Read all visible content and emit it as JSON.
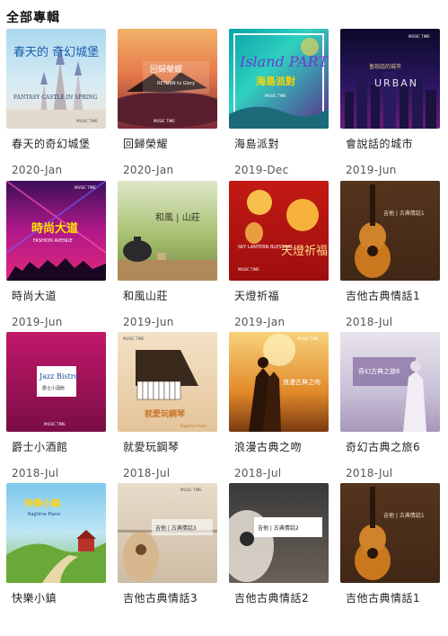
{
  "page_title": "全部專輯",
  "albums": [
    {
      "name": "春天的奇幻城堡",
      "date": "2020-Jan",
      "cover_text": "春天的 奇幻城堡",
      "cover_sub": "FANTASY CASTLE IN SPRING",
      "badge": "MUSIC TIME"
    },
    {
      "name": "回歸榮耀",
      "date": "2020-Jan",
      "cover_text": "回歸榮耀",
      "cover_sub": "RETURN to Glory",
      "badge": "MUSIC TIME"
    },
    {
      "name": "海島派對",
      "date": "2019-Dec",
      "cover_text": "海島派對",
      "cover_sub": "Island PARTY",
      "badge": "MUSIC TIME"
    },
    {
      "name": "會說話的城市",
      "date": "2019-Jun",
      "cover_text": "會說話的城市",
      "cover_sub": "URBAN",
      "badge": "MUSIC TIME"
    },
    {
      "name": "時尚大道",
      "date": "2019-Jun",
      "cover_text": "時尚大道",
      "cover_sub": "FASHION AVENUE",
      "badge": "MUSIC TIME"
    },
    {
      "name": "和風山莊",
      "date": "2019-Jun",
      "cover_text": "和風 | 山莊",
      "cover_sub": "",
      "badge": ""
    },
    {
      "name": "天燈祈福",
      "date": "2019-Jan",
      "cover_text": "天燈祈福",
      "cover_sub": "SKY LANTERN BLESSING",
      "badge": "MUSIC TIME"
    },
    {
      "name": "吉他古典情話1",
      "date": "2018-Jul",
      "cover_text": "吉他 | 古典情話1",
      "cover_sub": "",
      "badge": ""
    },
    {
      "name": "爵士小酒館",
      "date": "2018-Jul",
      "cover_text": "Jazz Bistro",
      "cover_sub": "爵士小酒館",
      "badge": "MUSIC TIME"
    },
    {
      "name": "就愛玩鋼琴",
      "date": "2018-Jul",
      "cover_text": "就愛玩鋼琴",
      "cover_sub": "Ragtime Piano",
      "badge": "MUSIC TIME"
    },
    {
      "name": "浪漫古典之吻",
      "date": "2018-Jul",
      "cover_text": "浪漫古典之吻",
      "cover_sub": "",
      "badge": "MUSIC TIME"
    },
    {
      "name": "奇幻古典之旅6",
      "date": "2018-Jul",
      "cover_text": "奇幻古典之旅6",
      "cover_sub": "",
      "badge": ""
    },
    {
      "name": "快樂小鎮",
      "date": "",
      "cover_text": "快樂小鎮",
      "cover_sub": "Ragtime Piano",
      "badge": ""
    },
    {
      "name": "吉他古典情話3",
      "date": "",
      "cover_text": "吉他 | 古典情話3",
      "cover_sub": "",
      "badge": "MUSIC TIME"
    },
    {
      "name": "吉他古典情話2",
      "date": "",
      "cover_text": "吉他 | 古典情話2",
      "cover_sub": "",
      "badge": ""
    },
    {
      "name": "吉他古典情話1",
      "date": "",
      "cover_text": "吉他 | 古典情話1",
      "cover_sub": "",
      "badge": ""
    }
  ]
}
